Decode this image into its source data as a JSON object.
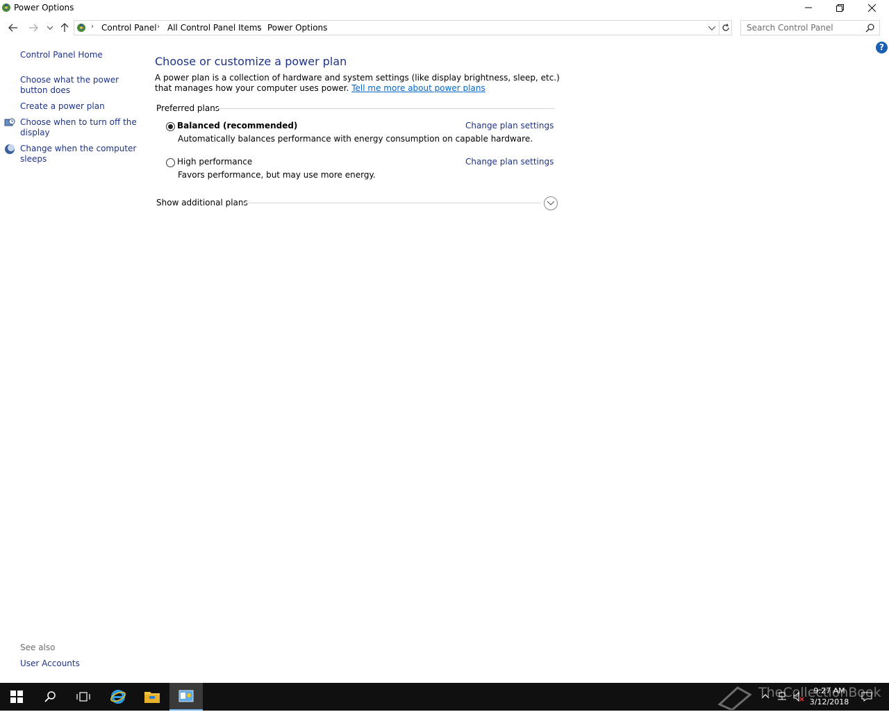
{
  "window": {
    "title": "Power Options"
  },
  "address": {
    "crumbs": [
      "Control Panel",
      "All Control Panel Items",
      "Power Options"
    ],
    "search_placeholder": "Search Control Panel"
  },
  "sidebar": {
    "home": "Control Panel Home",
    "items": [
      {
        "label": "Choose what the power button does",
        "icon": null
      },
      {
        "label": "Create a power plan",
        "icon": null
      },
      {
        "label": "Choose when to turn off the display",
        "icon": "display-clock-icon"
      },
      {
        "label": "Change when the computer sleeps",
        "icon": "moon-icon"
      }
    ],
    "see_also_label": "See also",
    "see_also_items": [
      "User Accounts"
    ]
  },
  "main": {
    "title": "Choose or customize a power plan",
    "description": "A power plan is a collection of hardware and system settings (like display brightness, sleep, etc.) that manages how your computer uses power.",
    "learn_more_link": "Tell me more about power plans",
    "preferred_plans_label": "Preferred plans",
    "plans": [
      {
        "name": "Balanced (recommended)",
        "description": "Automatically balances performance with energy consumption on capable hardware.",
        "selected": true,
        "link": "Change plan settings"
      },
      {
        "name": "High performance",
        "description": "Favors performance, but may use more energy.",
        "selected": false,
        "link": "Change plan settings"
      }
    ],
    "show_additional_plans": "Show additional plans"
  },
  "taskbar": {
    "pinned": [
      "start-icon",
      "search-icon",
      "task-view-icon",
      "internet-explorer-icon",
      "file-explorer-icon",
      "control-panel-icon"
    ],
    "time": "9:27 AM",
    "date": "3/12/2018",
    "watermark": "TheCollectionBook"
  },
  "colors": {
    "link": "#1e3287",
    "hyperlink": "#0066cc",
    "taskbar": "#101010",
    "accent": "#76b9ed"
  }
}
